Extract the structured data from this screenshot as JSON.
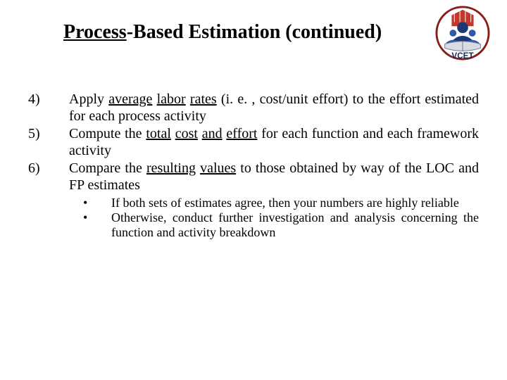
{
  "title": {
    "part_underlined": "Process",
    "part_rest": "-Based Estimation (continued)"
  },
  "logo": {
    "label": "VCET"
  },
  "items": [
    {
      "num": "4)",
      "seg1": "Apply ",
      "u1": "average",
      "seg2": " ",
      "u2": "labor",
      "seg3": " ",
      "u3": "rates",
      "seg4": " (i. e. , cost/unit effort) to the effort estimated for each process activity"
    },
    {
      "num": "5)",
      "seg1": "Compute the ",
      "u1": "total",
      "seg2": " ",
      "u2": "cost",
      "seg3": " ",
      "u3": "and",
      "seg4": " ",
      "u4": "effort",
      "seg5": " for each function and each framework activity"
    },
    {
      "num": "6)",
      "seg1": "Compare the ",
      "u1": "resulting",
      "seg2": " ",
      "u2": "values",
      "seg3": " to those obtained by way of the LOC and FP estimates"
    }
  ],
  "subitems": [
    {
      "bullet": "•",
      "text": "If both sets of estimates agree, then your numbers are highly reliable"
    },
    {
      "bullet": "•",
      "text": "Otherwise, conduct further investigation and analysis concerning the function and activity breakdown"
    }
  ]
}
